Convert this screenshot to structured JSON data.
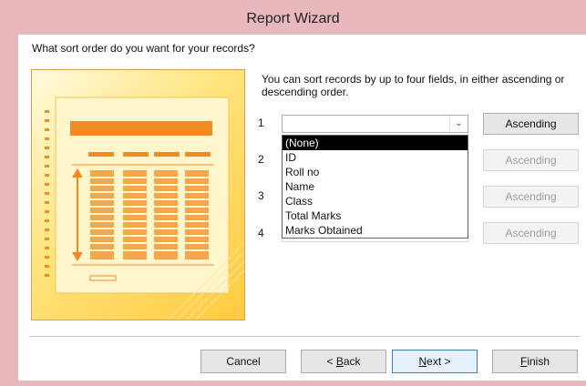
{
  "window": {
    "title": "Report Wizard"
  },
  "prompt": "What sort order do you want for your records?",
  "info": "You can sort records by up to four fields, in either ascending or descending order.",
  "sort_rows": [
    {
      "number": "1",
      "selected": "",
      "order": "Ascending",
      "enabled": true
    },
    {
      "number": "2",
      "order": "Ascending",
      "enabled": false
    },
    {
      "number": "3",
      "order": "Ascending",
      "enabled": false
    },
    {
      "number": "4",
      "order": "Ascending",
      "enabled": false
    }
  ],
  "dropdown_options": [
    "(None)",
    "ID",
    "Roll no",
    "Name",
    "Class",
    "Total Marks",
    "Marks Obtained"
  ],
  "highlighted_option": "(None)",
  "buttons": {
    "cancel": "Cancel",
    "back_prefix": "< ",
    "back_mnemonic": "B",
    "back_rest": "ack",
    "next_mnemonic": "N",
    "next_rest": "ext >",
    "finish_mnemonic": "F",
    "finish_rest": "inish"
  },
  "colors": {
    "title_bar": "#e9b8bd",
    "illustration_orange": "#f08a24",
    "selection": "#000000"
  },
  "icons": {
    "dropdown_arrow": "chevron-down-icon"
  }
}
